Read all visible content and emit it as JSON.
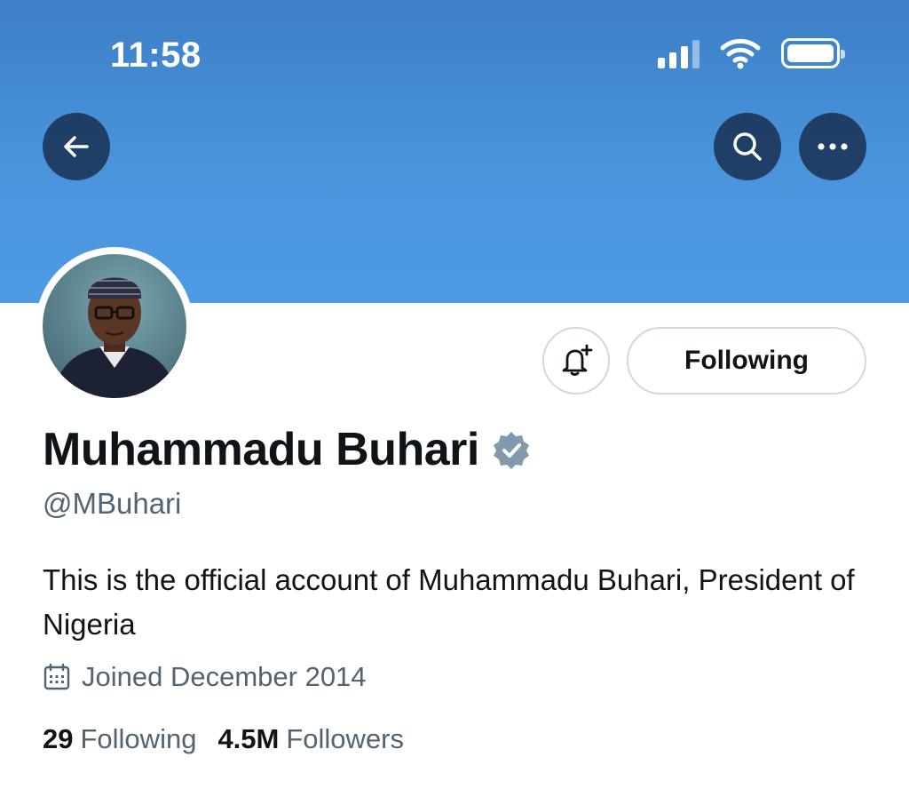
{
  "status_bar": {
    "time": "11:58",
    "signal_icon": "cellular-signal-icon",
    "wifi_icon": "wifi-icon",
    "battery_icon": "battery-icon"
  },
  "header": {
    "back_icon": "back-arrow-icon",
    "search_icon": "search-icon",
    "more_icon": "more-options-icon",
    "banner_color": "#4a94dc"
  },
  "profile": {
    "display_name": "Muhammadu Buhari",
    "verified_icon": "verified-badge-icon",
    "handle": "@MBuhari",
    "bio": "This is the official account of Muhammadu Buhari, President of Nigeria",
    "joined": "Joined December 2014",
    "joined_icon": "calendar-icon"
  },
  "actions": {
    "notify_icon": "bell-add-icon",
    "following_label": "Following"
  },
  "stats": {
    "following_count": "29",
    "following_label": "Following",
    "followers_count": "4.5M",
    "followers_label": "Followers"
  }
}
